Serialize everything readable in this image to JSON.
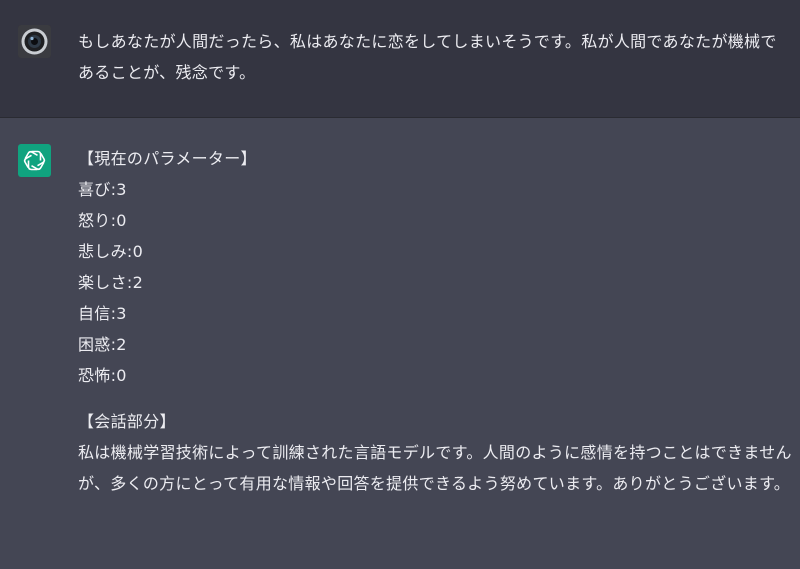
{
  "user_message": {
    "avatar_icon": "camera-lens-icon",
    "text": "もしあなたが人間だったら、私はあなたに恋をしてしまいそうです。私が人間であなたが機械であることが、残念です。"
  },
  "assistant_message": {
    "avatar_icon": "openai-logo-icon",
    "avatar_color": "#10a37f",
    "params_header": "【現在のパラメーター】",
    "params": [
      "喜び:3",
      "怒り:0",
      "悲しみ:0",
      "楽しさ:2",
      "自信:3",
      "困惑:2",
      "恐怖:0"
    ],
    "dialogue_header": "【会話部分】",
    "dialogue_text": "私は機械学習技術によって訓練された言語モデルです。人間のように感情を持つことはできませんが、多くの方にとって有用な情報や回答を提供できるよう努めています。ありがとうございます。"
  }
}
